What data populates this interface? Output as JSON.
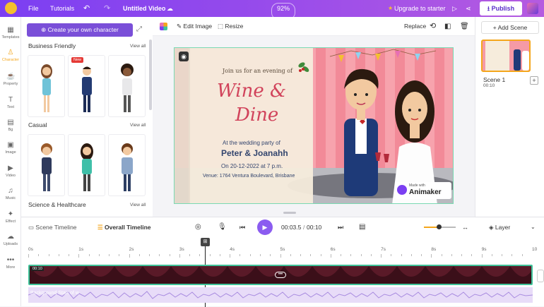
{
  "topbar": {
    "menu_file": "File",
    "menu_tutorials": "Tutorials",
    "title": "Untitled Video",
    "zoom": "92%",
    "upgrade": "Upgrade to starter",
    "publish": "Publish"
  },
  "leftnav": {
    "items": [
      {
        "label": "Templates",
        "icon": "templates-icon"
      },
      {
        "label": "Character",
        "icon": "character-icon"
      },
      {
        "label": "Property",
        "icon": "property-icon"
      },
      {
        "label": "Text",
        "icon": "text-icon"
      },
      {
        "label": "Bg",
        "icon": "background-icon"
      },
      {
        "label": "Image",
        "icon": "image-icon"
      },
      {
        "label": "Video",
        "icon": "video-icon"
      },
      {
        "label": "Music",
        "icon": "music-icon"
      },
      {
        "label": "Effect",
        "icon": "effect-icon"
      },
      {
        "label": "Uploads",
        "icon": "uploads-icon"
      },
      {
        "label": "More",
        "icon": "more-icon"
      }
    ]
  },
  "library": {
    "create_button": "Create your own character",
    "sections": [
      {
        "title": "Business Friendly",
        "view_all": "View all"
      },
      {
        "title": "Casual",
        "view_all": "View all"
      },
      {
        "title": "Science & Healthcare",
        "view_all": "View all"
      }
    ],
    "new_badge": "New"
  },
  "editor_toolbar": {
    "edit_image": "Edit Image",
    "resize": "Resize",
    "replace": "Replace"
  },
  "canvas": {
    "line1": "Join us for an evening of",
    "title_line1": "Wine &",
    "title_line2": "Dine",
    "party_line": "At the wedding party of",
    "names": "Peter & Joanahh",
    "date_line": "On 20-12-2022 at 7 p.m.",
    "venue": "Venue: 1764 Ventura Boulevard, Brisbane",
    "watermark_top": "Made with",
    "watermark_brand": "Animaker"
  },
  "scenes": {
    "add_scene": "+ Add Scene",
    "items": [
      {
        "name": "Scene 1",
        "duration": "00:10"
      }
    ]
  },
  "timeline": {
    "scene_timeline": "Scene Timeline",
    "overall_timeline": "Overall Timeline",
    "current_time": "00:03.5",
    "separator": "/",
    "total_time": "00:10",
    "layer": "Layer",
    "ruler": [
      "0s",
      "1s",
      "2s",
      "3s",
      "4s",
      "5s",
      "6s",
      "7s",
      "8s",
      "9s",
      "10"
    ],
    "track_time": "00:10",
    "audio_label": "Background Start of w"
  },
  "colors": {
    "brand": "#7b3ff2",
    "accent": "#f4a61c",
    "selection": "#3fc39a"
  }
}
